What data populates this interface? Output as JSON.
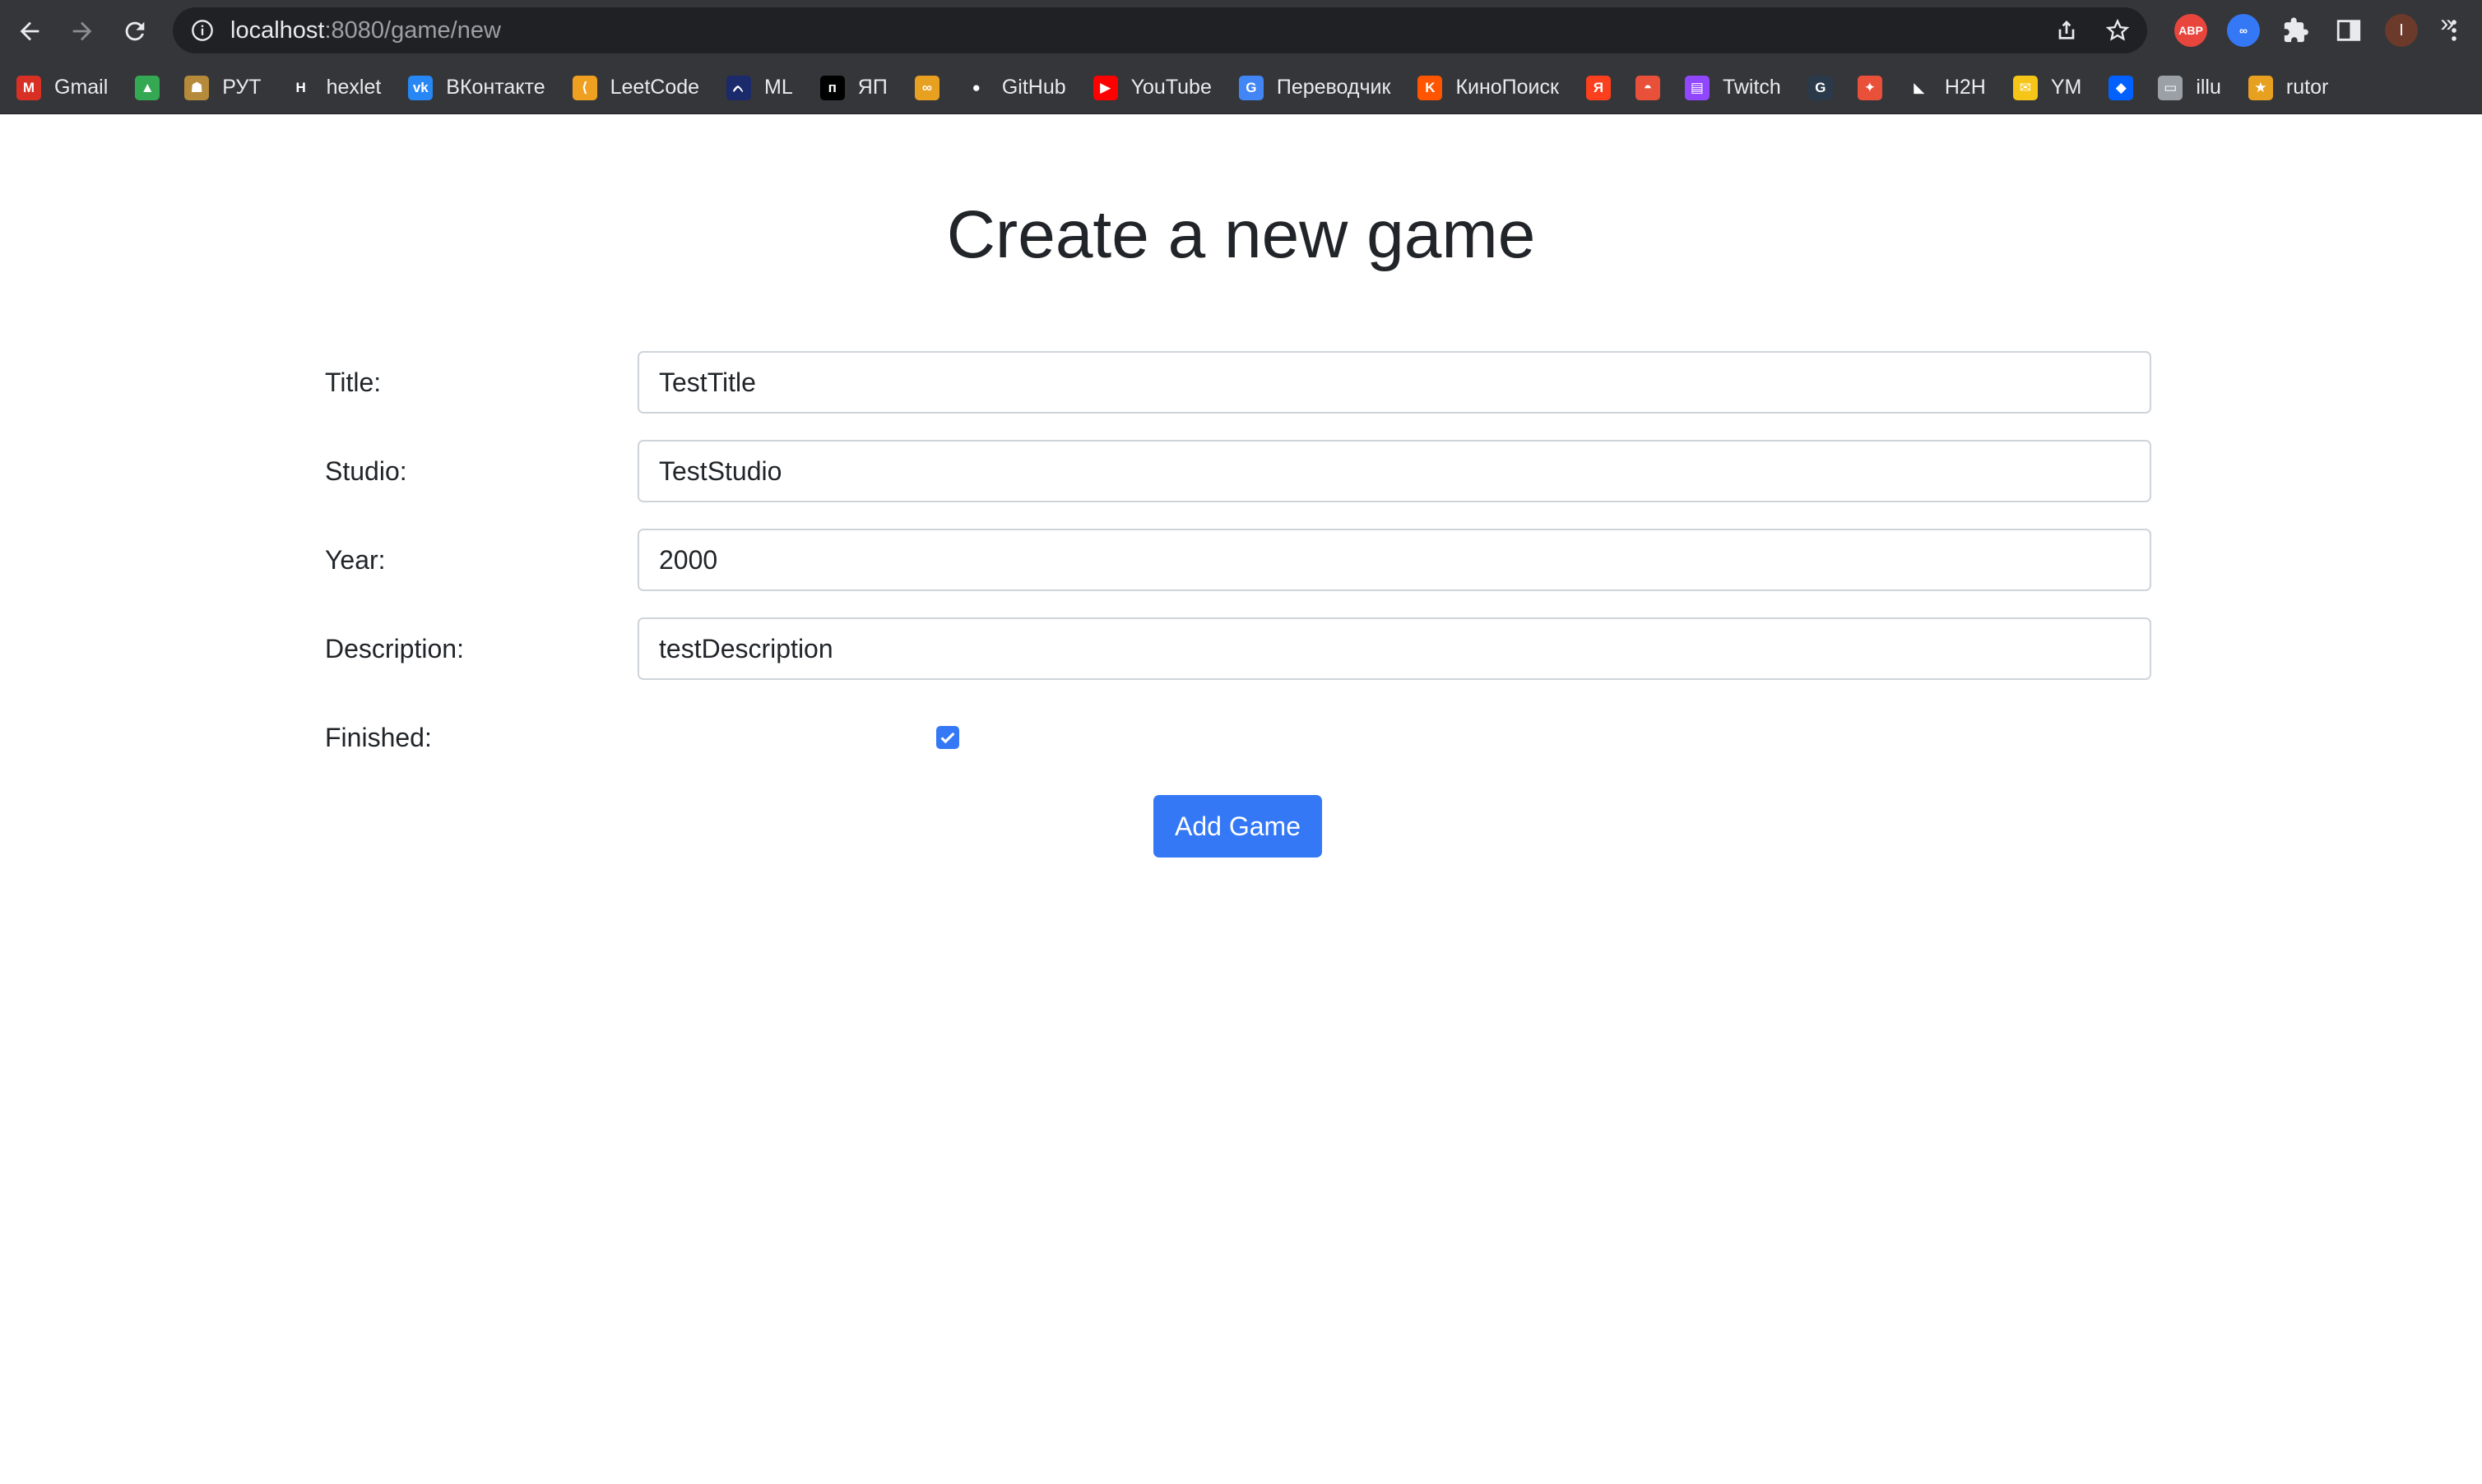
{
  "browser": {
    "url_host": "localhost",
    "url_rest": ":8080/game/new",
    "profile_initial": "I",
    "extensions": [
      "ABP"
    ],
    "bookmarks": [
      {
        "label": "Gmail",
        "icon": "gmail-icon",
        "color": "#d93025",
        "glyph": "M"
      },
      {
        "label": "",
        "icon": "google-drive-icon",
        "color": "#34a853",
        "glyph": "▲"
      },
      {
        "label": "РУТ",
        "icon": "rut-icon",
        "color": "#b58a3a",
        "glyph": "☗"
      },
      {
        "label": "hexlet",
        "icon": "hexlet-icon",
        "color": "#ffffff",
        "glyph": "H"
      },
      {
        "label": "ВКонтакте",
        "icon": "vk-icon",
        "color": "#2787f5",
        "glyph": "vk"
      },
      {
        "label": "LeetCode",
        "icon": "leetcode-icon",
        "color": "#f0a020",
        "glyph": "⟨"
      },
      {
        "label": "ML",
        "icon": "ml-icon",
        "color": "#1a2a6a",
        "glyph": "ᨈ"
      },
      {
        "label": "ЯП",
        "icon": "yap-icon",
        "color": "#000000",
        "glyph": "п"
      },
      {
        "label": "",
        "icon": "infinity-icon",
        "color": "#e8a020",
        "glyph": "∞"
      },
      {
        "label": "GitHub",
        "icon": "github-icon",
        "color": "#35363a",
        "glyph": "●"
      },
      {
        "label": "YouTube",
        "icon": "youtube-icon",
        "color": "#ff0000",
        "glyph": "▶"
      },
      {
        "label": "Переводчик",
        "icon": "translate-icon",
        "color": "#4285f4",
        "glyph": "G"
      },
      {
        "label": "КиноПоиск",
        "icon": "kinopoisk-icon",
        "color": "#ff5500",
        "glyph": "K"
      },
      {
        "label": "",
        "icon": "yandex-icon",
        "color": "#fc3f1d",
        "glyph": "Я"
      },
      {
        "label": "",
        "icon": "pokeball-icon",
        "color": "#e8503a",
        "glyph": "◓"
      },
      {
        "label": "Twitch",
        "icon": "twitch-icon",
        "color": "#9146ff",
        "glyph": "▤"
      },
      {
        "label": "",
        "icon": "gd-icon",
        "color": "#2a3a4a",
        "glyph": "G"
      },
      {
        "label": "",
        "icon": "star-badge-icon",
        "color": "#e8503a",
        "glyph": "✦"
      },
      {
        "label": "H2H",
        "icon": "h2h-icon",
        "color": "#ffffff",
        "glyph": "◣"
      },
      {
        "label": "YM",
        "icon": "mail-icon",
        "color": "#f5c518",
        "glyph": "✉"
      },
      {
        "label": "",
        "icon": "dropbox-icon",
        "color": "#0061ff",
        "glyph": "◆"
      },
      {
        "label": "illu",
        "icon": "folder-icon",
        "color": "#9aa0a6",
        "glyph": "▭"
      },
      {
        "label": "rutor",
        "icon": "rutor-icon",
        "color": "#e8a020",
        "glyph": "★"
      }
    ],
    "more_glyph": "»"
  },
  "page": {
    "title": "Create a new game",
    "fields": [
      {
        "label": "Title:",
        "value": "TestTitle"
      },
      {
        "label": "Studio:",
        "value": "TestStudio"
      },
      {
        "label": "Year:",
        "value": "2000"
      },
      {
        "label": "Description:",
        "value": "testDescription"
      }
    ],
    "finished_label": "Finished:",
    "finished_checked": true,
    "submit_label": "Add Game"
  },
  "colors": {
    "accent": "#3478f6",
    "chrome": "#35363a",
    "text": "#212529"
  }
}
